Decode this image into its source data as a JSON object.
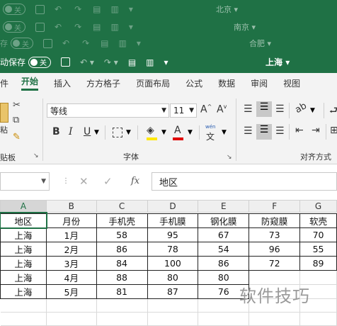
{
  "windows": [
    {
      "autosave": "",
      "toggle": "关",
      "city": "北京"
    },
    {
      "autosave": "",
      "toggle": "关",
      "city": "南京"
    },
    {
      "autosave": "存",
      "toggle": "关",
      "city": "合肥"
    },
    {
      "autosave": "动保存",
      "toggle": "关",
      "city": "上海"
    }
  ],
  "tabs": [
    "件",
    "开始",
    "插入",
    "方方格子",
    "页面布局",
    "公式",
    "数据",
    "审阅",
    "视图"
  ],
  "ribbon": {
    "paste_label": "粘",
    "clipboard_label": "贴板",
    "font_name": "等线",
    "font_size": "11",
    "bold": "B",
    "italic": "I",
    "underline": "U",
    "font_group_label": "字体",
    "align_group_label": "对齐方式",
    "wen_top": "wén",
    "wen_bottom": "文",
    "highlight_color": "#ffe800",
    "font_color": "#e00000"
  },
  "formula_bar": {
    "cell_ref": "",
    "fx": "fx",
    "content": "地区"
  },
  "columns": [
    "A",
    "B",
    "C",
    "D",
    "E",
    "F",
    "G"
  ],
  "rows": [
    [
      "地区",
      "月份",
      "手机壳",
      "手机膜",
      "钢化膜",
      "防窥膜",
      "软壳"
    ],
    [
      "上海",
      "1月",
      "58",
      "95",
      "67",
      "73",
      "70"
    ],
    [
      "上海",
      "2月",
      "86",
      "78",
      "54",
      "96",
      "55"
    ],
    [
      "上海",
      "3月",
      "84",
      "100",
      "86",
      "72",
      "89"
    ],
    [
      "上海",
      "4月",
      "88",
      "80",
      "80",
      "",
      ""
    ],
    [
      "上海",
      "5月",
      "81",
      "87",
      "76",
      "",
      ""
    ],
    [
      "",
      "",
      "",
      "",
      "",
      "",
      ""
    ],
    [
      "",
      "",
      "",
      "",
      "",
      "",
      ""
    ]
  ],
  "watermark": "软件技巧",
  "colors": {
    "excel_green": "#1f7145",
    "ribbon_bg": "#f3f3f3"
  }
}
